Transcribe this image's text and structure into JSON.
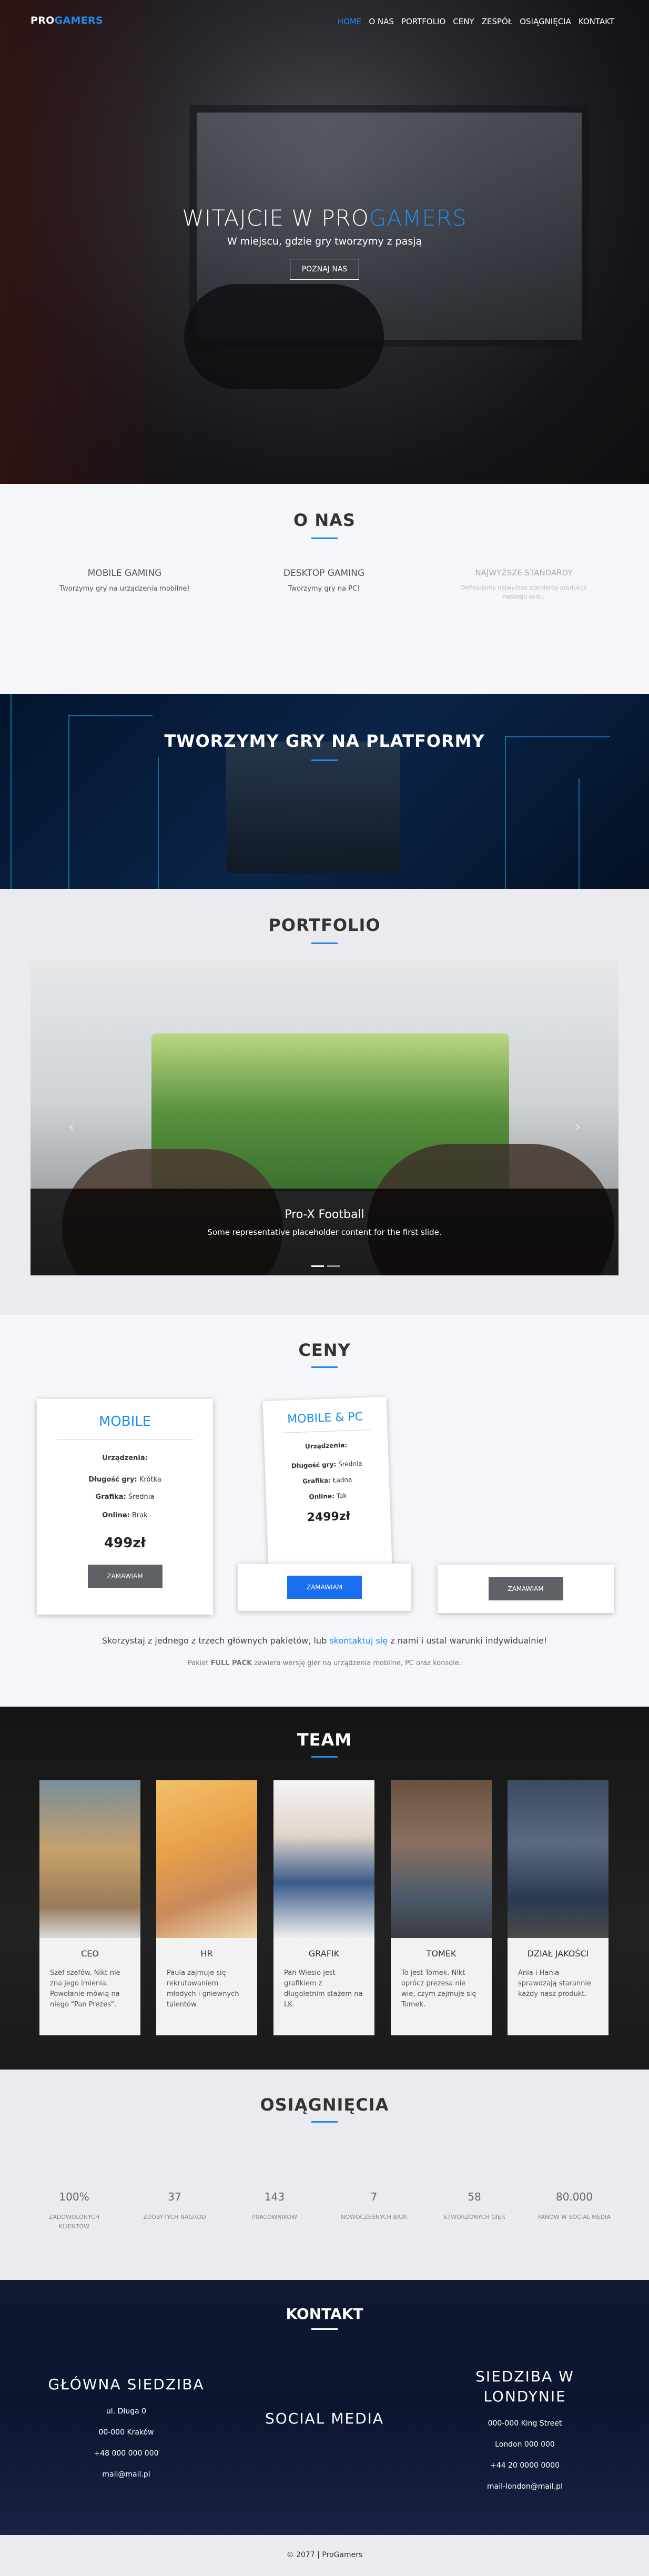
{
  "nav": {
    "brand_main": "PRO",
    "brand_accent": "GAMERS",
    "items": [
      "HOME",
      "O NAS",
      "PORTFOLIO",
      "CENY",
      "ZESPÓŁ",
      "OSIĄGNIĘCIA",
      "KONTAKT"
    ]
  },
  "hero": {
    "title_main": "WITAJCIE W PRO",
    "title_accent": "GAMERS",
    "subtitle": "W miejscu, gdzie gry tworzymy z pasją",
    "button": "POZNAJ NAS"
  },
  "about": {
    "title": "O NAS",
    "features": [
      {
        "title": "MOBILE GAMING",
        "text": "Tworzymy gry na urządzenia mobilne!"
      },
      {
        "title": "DESKTOP GAMING",
        "text": "Tworzymy gry na PC!"
      },
      {
        "title": "NAJWYŻSZE STANDARDY",
        "text": "Definiujemy najwyższe standardy produkcji naszego kodu."
      }
    ]
  },
  "platforms": {
    "title": "TWORZYMY GRY NA PLATFORMY"
  },
  "portfolio": {
    "title": "PORTFOLIO",
    "slide": {
      "title": "Pro-X Football",
      "text": "Some representative placeholder content for the first slide."
    },
    "arrow_prev": "‹",
    "arrow_next": "›"
  },
  "pricing": {
    "title": "CENY",
    "cards": [
      {
        "name": "MOBILE",
        "rows": [
          {
            "label": "Urządzenia:",
            "value": ""
          },
          {
            "label": "Długość gry:",
            "value": "Krótka"
          },
          {
            "label": "Grafika:",
            "value": "Średnia"
          },
          {
            "label": "Online:",
            "value": "Brak"
          }
        ],
        "price": "499zł",
        "button": "ZAMAWIAM"
      },
      {
        "name": "MOBILE & PC",
        "rows": [
          {
            "label": "Urządzenia:",
            "value": ""
          },
          {
            "label": "Długość gry:",
            "value": "Średnia"
          },
          {
            "label": "Grafika:",
            "value": "Ładna"
          },
          {
            "label": "Online:",
            "value": "Tak"
          }
        ],
        "price": "2499zł",
        "button": "ZAMAWIAM"
      },
      {
        "name": "",
        "rows": [],
        "price": "",
        "button": "ZAMAWIAM"
      }
    ],
    "note_before": "Skorzystaj z jednego z trzech głównych pakietów, lub ",
    "note_link": "skontaktuj się",
    "note_after": " z nami i ustal warunki indywidualnie!",
    "note2_before": "Pakiet ",
    "note2_bold": "FULL PACK",
    "note2_after": " zawiera wersję gier na urządzenia mobilne, PC oraz konsole.",
    "colors": {
      "accent": "#1d8cf2",
      "button_gray": "#5e6266",
      "button_blue": "#1a6ff0"
    }
  },
  "team": {
    "title": "TEAM",
    "members": [
      {
        "role": "CEO",
        "text": "Szef szefów. Nikt nie zna jego imienia. Powołanie mówią na niego \"Pan Prezes\".",
        "photo": "bearded-man-photo"
      },
      {
        "role": "HR",
        "text": "Paula zajmuje się rekrutowaniem młodych i gniewnych talentów.",
        "photo": "woman-photo"
      },
      {
        "role": "GRAFIK",
        "text": "Pan Wiesio jest grafikiem z długoletnim stażem na LK.",
        "photo": "builder-photo"
      },
      {
        "role": "TOMEK",
        "text": "To jest Tomek. Nikt oprócz prezesa nie wie, czym zajmuje się Tomek.",
        "photo": "office-man-photo"
      },
      {
        "role": "DZIAŁ JAKOŚCI",
        "text": "Ania i Hania sprawdzają starannie każdy nasz produkt.",
        "photo": "team-photo"
      }
    ]
  },
  "achievements": {
    "title": "OSIĄGNIĘCIA",
    "stats": [
      {
        "value": "100%",
        "label": "ZADOWOLONYCH KLIENTÓW"
      },
      {
        "value": "37",
        "label": "ZDOBYTYCH NAGRÓD"
      },
      {
        "value": "143",
        "label": "PRACOWNIKÓW"
      },
      {
        "value": "7",
        "label": "NOWOCZESNYCH BIUR"
      },
      {
        "value": "58",
        "label": "STWORZONYCH GIER"
      },
      {
        "value": "80.000",
        "label": "FANÓW W SOCIAL MEDIA"
      }
    ]
  },
  "contact": {
    "title": "KONTAKT",
    "main": {
      "title": "GŁÓWNA SIEDZIBA",
      "lines": [
        "ul. Długa 0",
        "00-000 Kraków",
        "+48 000 000 000",
        "mail@mail.pl"
      ]
    },
    "social": {
      "title": "SOCIAL MEDIA"
    },
    "london": {
      "title_1": "SIEDZIBA W",
      "title_2": "LONDYNIE",
      "lines": [
        "000-000 King Street",
        "London 000 000",
        "+44 20 0000 0000",
        "mail-london@mail.pl"
      ]
    }
  },
  "footer": {
    "text": "© 2077 | ProGamers"
  }
}
